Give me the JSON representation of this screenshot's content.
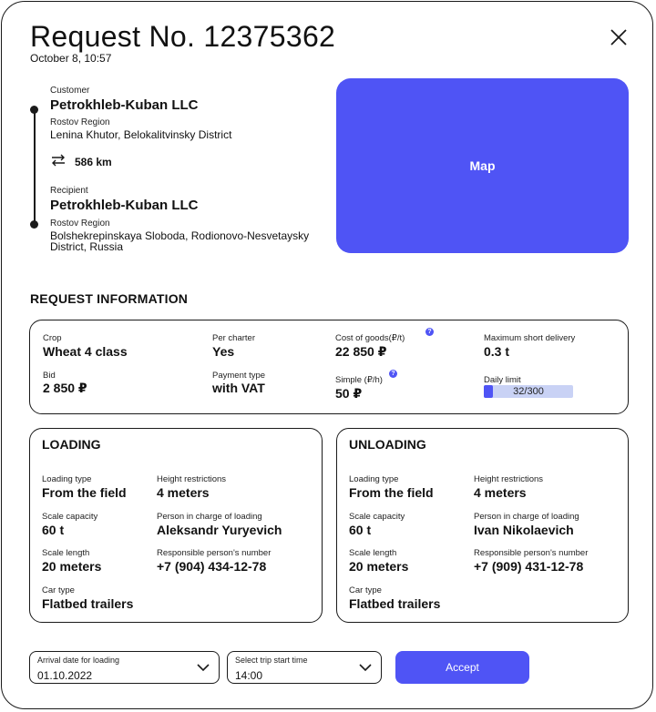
{
  "header": {
    "title": "Request No. 12375362",
    "date": "October 8, 10:57"
  },
  "route": {
    "customer": {
      "label": "Customer",
      "company": "Petrokhleb-Kuban LLC",
      "region": "Rostov Region",
      "address": "Lenina Khutor, Belokalitvinsky District"
    },
    "distance": "586 km",
    "recipient": {
      "label": "Recipient",
      "company": "Petrokhleb-Kuban LLC",
      "region": "Rostov Region",
      "address_line1": "Bolshekrepinskaya Sloboda, Rodionovo-Nesvetaysky",
      "address_line2": "District, Russia"
    }
  },
  "map": {
    "label": "Map",
    "color": "#4f54f5"
  },
  "request_info": {
    "title": "REQUEST INFORMATION",
    "crop": {
      "label": "Crop",
      "value": "Wheat 4 class"
    },
    "per_charter": {
      "label": "Per charter",
      "value": "Yes"
    },
    "cost": {
      "label": "Cost of goods(₽/t)",
      "value": "22 850 ₽",
      "help": "?"
    },
    "max_short": {
      "label": "Maximum short delivery",
      "value": "0.3 t"
    },
    "bid": {
      "label": "Bid",
      "value": "2 850 ₽"
    },
    "payment": {
      "label": "Payment type",
      "value": "with VAT"
    },
    "simple": {
      "label": "Simple (₽/h)",
      "value": "50 ₽",
      "help": "?"
    },
    "daily_limit": {
      "label": "Daily limit",
      "text": "32/300",
      "used": 32,
      "total": 300
    }
  },
  "loading": {
    "title": "LOADING",
    "loading_type": {
      "label": "Loading type",
      "value": "From the field"
    },
    "height": {
      "label": "Height restrictions",
      "value": "4 meters"
    },
    "scale_capacity": {
      "label": "Scale capacity",
      "value": "60 t"
    },
    "person": {
      "label": "Person in charge of loading",
      "value": "Aleksandr Yuryevich"
    },
    "scale_length": {
      "label": "Scale length",
      "value": "20 meters"
    },
    "phone": {
      "label": "Responsible person's number",
      "value": "+7 (904) 434-12-78"
    },
    "car_type": {
      "label": "Car type",
      "value": "Flatbed trailers"
    }
  },
  "unloading": {
    "title": "UNLOADING",
    "loading_type": {
      "label": "Loading type",
      "value": "From the field"
    },
    "height": {
      "label": "Height restrictions",
      "value": "4 meters"
    },
    "scale_capacity": {
      "label": "Scale capacity",
      "value": "60 t"
    },
    "person": {
      "label": "Person in charge of loading",
      "value": "Ivan Nikolaevich"
    },
    "scale_length": {
      "label": "Scale length",
      "value": "20 meters"
    },
    "phone": {
      "label": "Responsible person's number",
      "value": "+7 (909) 431-12-78"
    },
    "car_type": {
      "label": "Car type",
      "value": "Flatbed trailers"
    }
  },
  "footer": {
    "arrival": {
      "label": "Arrival date for loading",
      "value": "01.10.2022"
    },
    "trip_start": {
      "label": "Select trip start time",
      "value": "14:00"
    },
    "accept_label": "Accept"
  },
  "icons": {
    "close": "close-icon",
    "distance": "swap-arrows-icon",
    "chevron": "chevron-down-icon",
    "help": "help-icon"
  }
}
